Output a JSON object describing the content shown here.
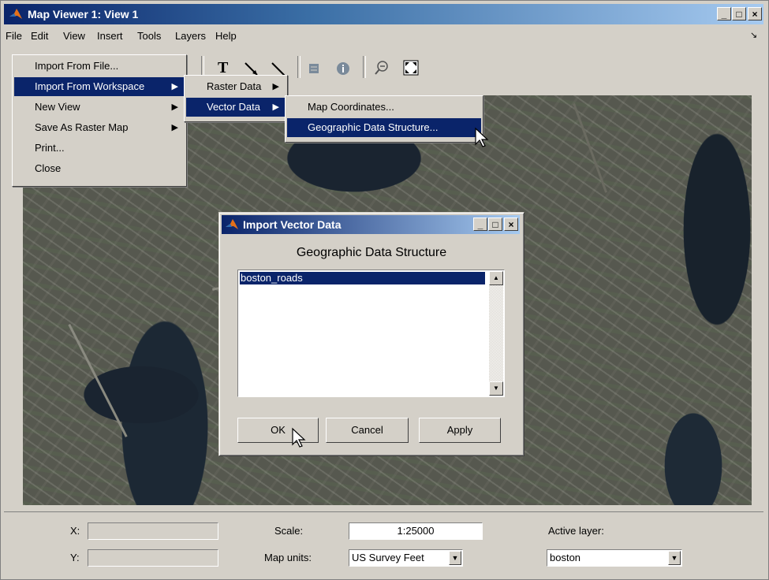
{
  "window": {
    "title": "Map Viewer 1: View 1",
    "controls": [
      "_",
      "□",
      "×"
    ]
  },
  "menubar": [
    "File",
    "Edit",
    "View",
    "Insert",
    "Tools",
    "Layers",
    "Help"
  ],
  "menubar_right_glyph": "↘",
  "file_menu": {
    "items": [
      "Import From File...",
      "Import From Workspace",
      "New View",
      "Save As Raster Map",
      "Print...",
      "Close"
    ],
    "selected": "Import From Workspace"
  },
  "workspace_submenu": {
    "items": [
      "Raster Data",
      "Vector Data"
    ],
    "selected": "Vector Data"
  },
  "vector_submenu": {
    "items": [
      "Map Coordinates...",
      "Geographic Data Structure..."
    ],
    "selected": "Geographic Data Structure..."
  },
  "toolbar": {
    "text_tool": "T"
  },
  "dialog": {
    "title": "Import Vector Data",
    "heading": "Geographic Data Structure",
    "list_items": [
      "boston_roads"
    ],
    "selected_item": "boston_roads",
    "ok_label": "OK",
    "cancel_label": "Cancel",
    "apply_label": "Apply"
  },
  "status": {
    "x_label": "X:",
    "y_label": "Y:",
    "x_value": "",
    "y_value": "",
    "scale_label": "Scale:",
    "scale_value": "1:25000",
    "map_units_label": "Map units:",
    "map_units_value": "US Survey Feet",
    "active_layer_label": "Active layer:",
    "active_layer_value": "boston"
  },
  "colors": {
    "selection": "#0a246a",
    "face": "#d4d0c8"
  }
}
